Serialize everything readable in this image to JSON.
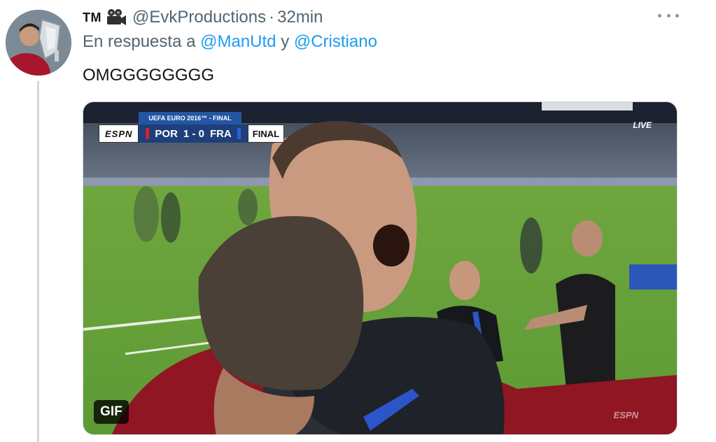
{
  "author": {
    "display_name": "TM",
    "camera_icon": "movie-camera-icon",
    "handle": "@EvkProductions",
    "separator": "·",
    "time": "32min"
  },
  "reply": {
    "prefix": "En respuesta a",
    "mention_1": "@ManUtd",
    "conjunction": "y",
    "mention_2": "@Cristiano"
  },
  "tweet": {
    "text": "OMGGGGGGGG"
  },
  "media": {
    "type": "gif",
    "badge_label": "GIF",
    "scorebug": {
      "network": "ESPN",
      "competition": "UEFA EURO 2016™ - FINAL",
      "home_team": "POR",
      "score": "1 - 0",
      "away_team": "FRA",
      "status": "FINAL"
    },
    "live_label": "LIVE",
    "corner_logo": "ESPN"
  },
  "colors": {
    "accent": "#1d9bf0",
    "secondary_text": "#536471",
    "primary_text": "#0f1419",
    "thread_line": "#cfd9de"
  }
}
